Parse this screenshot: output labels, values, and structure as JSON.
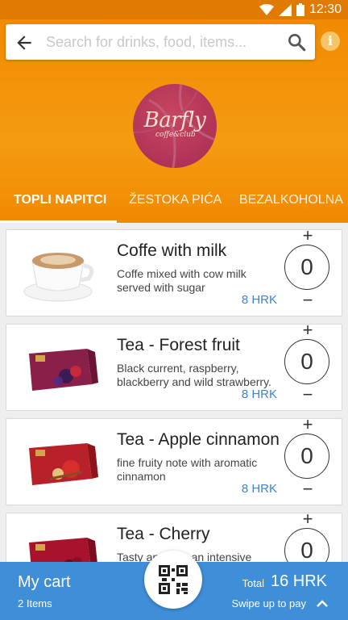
{
  "status": {
    "time": "12:30"
  },
  "search": {
    "placeholder": "Search for drinks, food, items..."
  },
  "logo": {
    "name": "Barfly",
    "subtitle": "coffe&club"
  },
  "tabs": [
    {
      "label": "TOPLI NAPITCI",
      "active": true
    },
    {
      "label": "ŽESTOKA PIĆA",
      "active": false
    },
    {
      "label": "BEZALKOHOLNA",
      "active": false
    }
  ],
  "items": [
    {
      "name": "Coffe with milk",
      "description": "Coffe mixed with cow milk served with sugar",
      "price": "8 HRK",
      "quantity": "0",
      "plus": "+",
      "minus": "−",
      "image": "coffee-cup-image"
    },
    {
      "name": "Tea - Forest fruit",
      "description": "Black current, raspberry, blackberry and wild strawberry.",
      "price": "8 HRK",
      "quantity": "0",
      "plus": "+",
      "minus": "−",
      "image": "tea-box-forest-fruit-image"
    },
    {
      "name": "Tea - Apple cinnamon",
      "description": "fine fruity note with aromatic cinnamon",
      "price": "8 HRK",
      "quantity": "0",
      "plus": "+",
      "minus": "−",
      "image": "tea-box-apple-cinnamon-image"
    },
    {
      "name": "Tea - Cherry",
      "description": "Tasty and with an intensive",
      "price": "",
      "quantity": "0",
      "plus": "+",
      "minus": "−",
      "image": "tea-box-cherry-image"
    }
  ],
  "cart": {
    "title": "My cart",
    "count": "2 Items",
    "total_label": "Total",
    "total": "16 HRK",
    "swipe_hint": "Swipe up to pay"
  },
  "colors": {
    "header": "#f18a00",
    "cart_bar": "#3e8ed8",
    "price": "#3b84d6"
  }
}
